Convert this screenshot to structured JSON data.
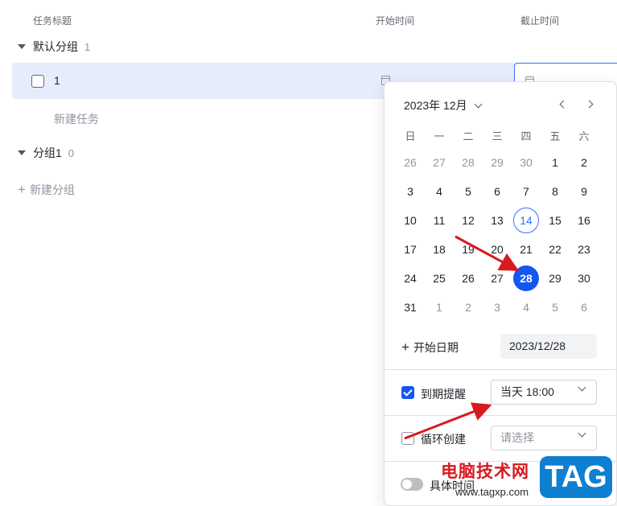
{
  "columns": {
    "title": "任务标题",
    "start": "开始时间",
    "deadline": "截止时间"
  },
  "groups": [
    {
      "name": "默认分组",
      "count": "1"
    },
    {
      "name": "分组1",
      "count": "0"
    }
  ],
  "task": {
    "title": "1",
    "checked": false
  },
  "new_task_label": "新建任务",
  "new_group_label": "新建分组",
  "calendar": {
    "month_label": "2023年 12月",
    "weekdays": [
      "日",
      "一",
      "二",
      "三",
      "四",
      "五",
      "六"
    ],
    "weeks": [
      [
        "26",
        "27",
        "28",
        "29",
        "30",
        "1",
        "2"
      ],
      [
        "3",
        "4",
        "5",
        "6",
        "7",
        "8",
        "9"
      ],
      [
        "10",
        "11",
        "12",
        "13",
        "14",
        "15",
        "16"
      ],
      [
        "17",
        "18",
        "19",
        "20",
        "21",
        "22",
        "23"
      ],
      [
        "24",
        "25",
        "26",
        "27",
        "28",
        "29",
        "30"
      ],
      [
        "31",
        "1",
        "2",
        "3",
        "4",
        "5",
        "6"
      ]
    ],
    "today": "14",
    "selected": "28"
  },
  "start_date_label": "开始日期",
  "date_value": "2023/12/28",
  "reminder": {
    "label": "到期提醒",
    "checked": true,
    "value": "当天 18:00"
  },
  "recurring": {
    "label": "循环创建",
    "checked": false,
    "placeholder": "请选择"
  },
  "specific_time": {
    "label": "具体时间",
    "on": false
  },
  "watermark": {
    "site_name": "电脑技术网",
    "url": "www.tagxp.com",
    "logo": "TAG"
  },
  "colors": {
    "accent": "#1456f0",
    "row_highlight": "#e6ecfb",
    "arrow": "#d8191f"
  }
}
